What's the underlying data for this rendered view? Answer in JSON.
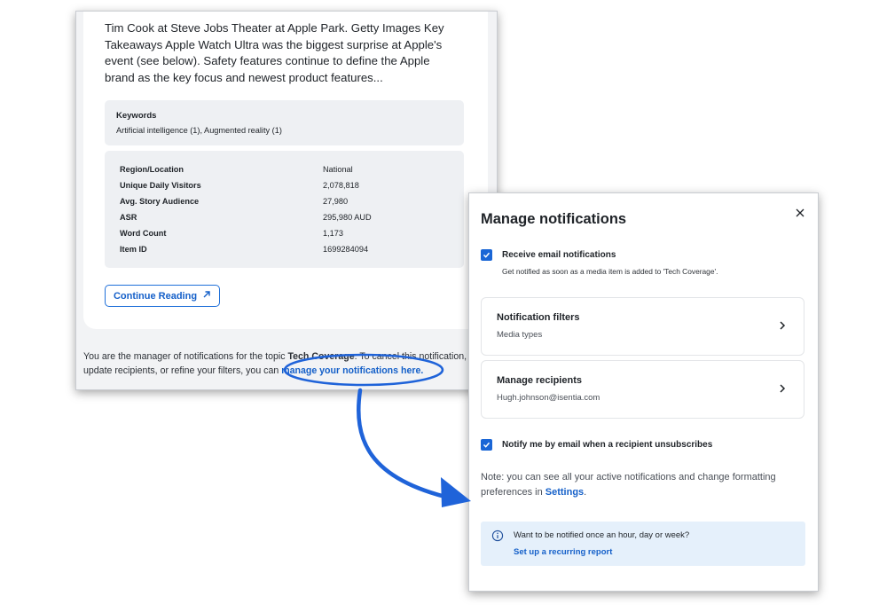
{
  "email": {
    "article_text": "Tim Cook at Steve Jobs Theater at Apple Park. Getty Images Key Takeaways Apple Watch Ultra was the biggest surprise at Apple's event (see below). Safety features continue to define the Apple brand as the key focus and newest product features...",
    "keywords": {
      "title": "Keywords",
      "value": "Artificial intelligence (1), Augmented reality (1)"
    },
    "meta": [
      {
        "label": "Region/Location",
        "value": "National"
      },
      {
        "label": "Unique Daily Visitors",
        "value": "2,078,818"
      },
      {
        "label": "Avg. Story Audience",
        "value": "27,980"
      },
      {
        "label": "ASR",
        "value": "295,980 AUD"
      },
      {
        "label": "Word Count",
        "value": "1,173"
      },
      {
        "label": "Item ID",
        "value": "1699284094"
      }
    ],
    "continue_label": "Continue Reading",
    "footer": {
      "line1_pre": "You are the manager of notifications for the topic ",
      "line1_topic": "Tech Coverage",
      "line1_post": ". To cancel this notification,",
      "line2_pre": "update recipients, or refine your filters, you can ",
      "line2_link": "manage your notifications here."
    }
  },
  "modal": {
    "title": "Manage notifications",
    "email_notifications": {
      "label": "Receive email notifications",
      "sub": "Get notified as soon as a media item is added to 'Tech Coverage'.",
      "checked": true
    },
    "filters": {
      "title": "Notification filters",
      "sub": "Media types"
    },
    "recipients": {
      "title": "Manage recipients",
      "sub": "Hugh.johnson@isentia.com"
    },
    "unsubscribe": {
      "label": "Notify me by email when a recipient unsubscribes",
      "checked": true
    },
    "note": {
      "pre": "Note: you can see all your active notifications and change formatting preferences in ",
      "link": "Settings",
      "post": "."
    },
    "info": {
      "text": "Want to be notified once an hour, day or week?",
      "link": "Set up a recurring report"
    }
  },
  "colors": {
    "accent": "#1a66d6",
    "annotation": "#1f63d9",
    "info_bg": "#e5f0fb"
  },
  "icons": {
    "close": "close-icon",
    "chevron": "chevron-right-icon",
    "check": "checkmark-icon",
    "info": "info-circle-icon",
    "external": "arrow-up-right-icon"
  }
}
